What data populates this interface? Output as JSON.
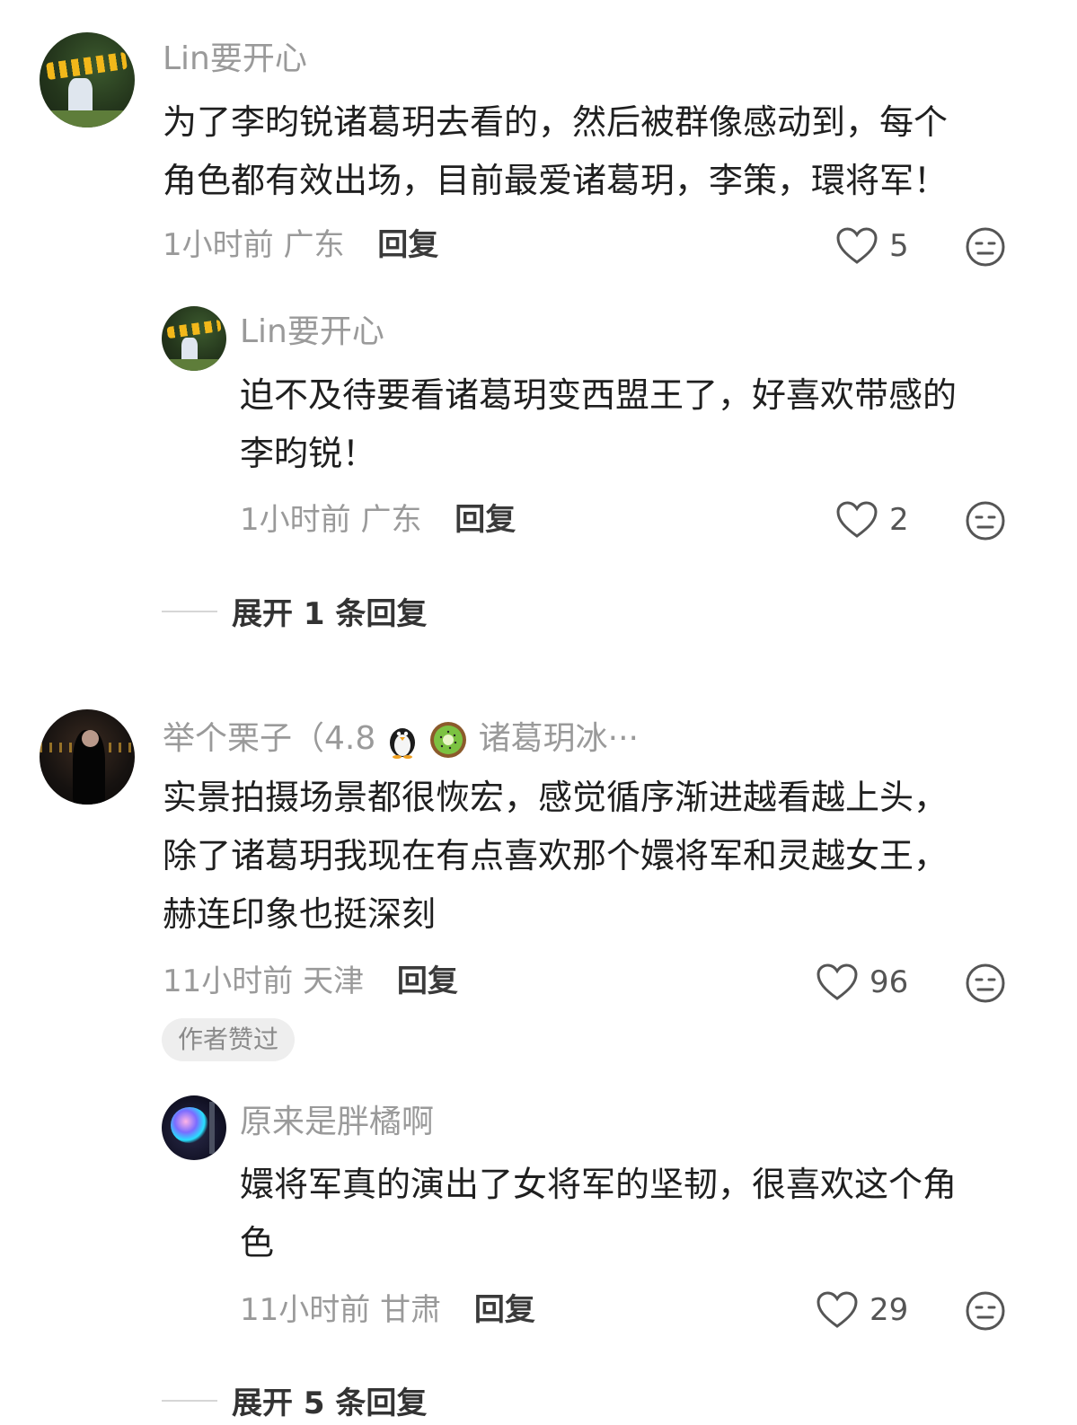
{
  "comments": [
    {
      "username": "Lin要开心",
      "lines": [
        "为了李昀锐诸葛玥去看的，然后被群像感动到，每个",
        "角色都有效出场，目前最爱诸葛玥，李策，環将军！"
      ],
      "time_location": "1小时前 广东",
      "reply_label": "回复",
      "likes": "5",
      "replies": [
        {
          "username": "Lin要开心",
          "lines": [
            "迫不及待要看诸葛玥变西盟王了，好喜欢带感的",
            "李昀锐！"
          ],
          "time_location": "1小时前 广东",
          "reply_label": "回复",
          "likes": "2"
        }
      ],
      "expand_label": "展开 1 条回复"
    },
    {
      "username_prefix": "举个栗子（4.8",
      "username_suffix": "诸葛玥冰···",
      "lines": [
        "实景拍摄场景都很恢宏，感觉循序渐进越看越上头，",
        "除了诸葛玥我现在有点喜欢那个嬛将军和灵越女王，",
        "赫连印象也挺深刻"
      ],
      "time_location": "11小时前 天津",
      "reply_label": "回复",
      "likes": "96",
      "author_badge": "作者赞过",
      "replies": [
        {
          "username": "原来是胖橘啊",
          "lines": [
            "嬛将军真的演出了女将军的坚韧，很喜欢这个角",
            "色"
          ],
          "time_location": "11小时前 甘肃",
          "reply_label": "回复",
          "likes": "29"
        }
      ],
      "expand_label": "展开 5 条回复"
    }
  ]
}
